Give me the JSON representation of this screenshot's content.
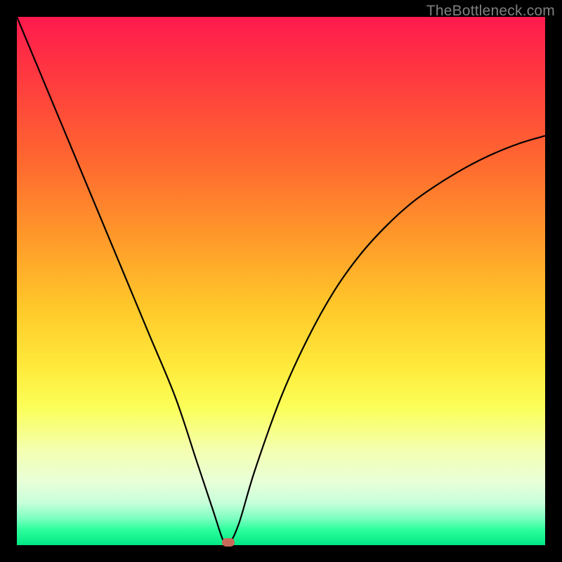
{
  "watermark": "TheBottleneck.com",
  "colors": {
    "frame_bg": "#000000",
    "curve": "#000000",
    "marker": "#c96a5a"
  },
  "chart_data": {
    "type": "line",
    "title": "",
    "xlabel": "",
    "ylabel": "",
    "xlim": [
      0,
      100
    ],
    "ylim": [
      0,
      100
    ],
    "grid": false,
    "legend": false,
    "annotations": [
      {
        "type": "marker",
        "x": 40,
        "y": 0
      }
    ],
    "series": [
      {
        "name": "curve",
        "x": [
          0,
          5,
          10,
          15,
          20,
          25,
          30,
          34,
          37,
          39,
          40,
          42,
          45,
          50,
          55,
          60,
          65,
          70,
          75,
          80,
          85,
          90,
          95,
          100
        ],
        "y": [
          100,
          88,
          76,
          64,
          52,
          40,
          28,
          16,
          7,
          1,
          0,
          4,
          14,
          28,
          39,
          48,
          55,
          60.5,
          65,
          68.5,
          71.5,
          74,
          76,
          77.5
        ]
      }
    ]
  }
}
